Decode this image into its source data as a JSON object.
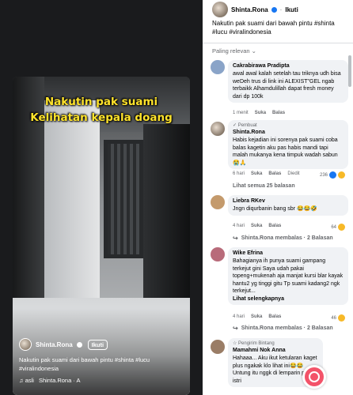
{
  "video": {
    "caption_lines": [
      "Nakutin pak suami",
      "Kelihatan kepala doang"
    ],
    "author": "Shinta.Rona",
    "follow_label": "Ikuti",
    "description": "Nakutin pak suami dari bawah pintu #shinta #lucu #viralindonesia",
    "music_prefix": "♫ asli",
    "music_text": "Shinta.Rona · A"
  },
  "panel": {
    "author": "Shinta.Rona",
    "dot": "·",
    "follow_label": "Ikuti",
    "description": "Nakutin pak suami dari bawah pintu #shinta #lucu #viralindonesia",
    "sort_label": "Paling relevan ⌄"
  },
  "comments": [
    {
      "author": "Cakrabirawa Pradipta",
      "text": "awal awal kalah setelah tau triknya udh bisa weDeh trus di link ini ALEXIST\"GEL ngab terbaikk Alhamdulillah dapat fresh money dari dp 100k",
      "time": "1 menit",
      "like": "Suka",
      "reply": "Balas"
    },
    {
      "badge": "✓ Pembuat",
      "author": "Shinta.Rona",
      "text": "Habis kejadian ini sorenya pak suami coba balas kagetin aku pas habis mandi tapi malah mukanya kena timpuk wadah sabun 😭🙏",
      "time": "6 hari",
      "like": "Suka",
      "reply": "Balas",
      "extra": "Diedit",
      "count": "236",
      "see_replies": "Lihat semua 25 balasan"
    },
    {
      "author": "Liebra RKev",
      "text": "Jngn diqurbanin bang sbr 😂😂🤣",
      "time": "4 hari",
      "like": "Suka",
      "reply": "Balas",
      "count": "64",
      "replier": "Shinta.Rona membalas · 2 Balasan"
    },
    {
      "author": "Wike Efrina",
      "text": "Bahagianya ih punya suami gampang terkejut gini Saya udah pakai topeng+mukenah aja manjat kursi blar kayak hantu2 yg tinggi gitu Tp suami kadang2 ngk terkejut...",
      "see_more": "Lihat selengkapnya",
      "time": "4 hari",
      "like": "Suka",
      "reply": "Balas",
      "count": "46",
      "replier": "Shinta.Rona membalas · 2 Balasan"
    },
    {
      "badge": "☆ Pengirim Bintang",
      "author": "Mamahmi Nok Anna",
      "text": "Hahaaa... Aku ikut ketularan kaget plus ngakak klo lihat ini😂😂 Untung itu nggk di lemparin pas ke istri",
      "time": "",
      "like": "",
      "reply": ""
    }
  ]
}
